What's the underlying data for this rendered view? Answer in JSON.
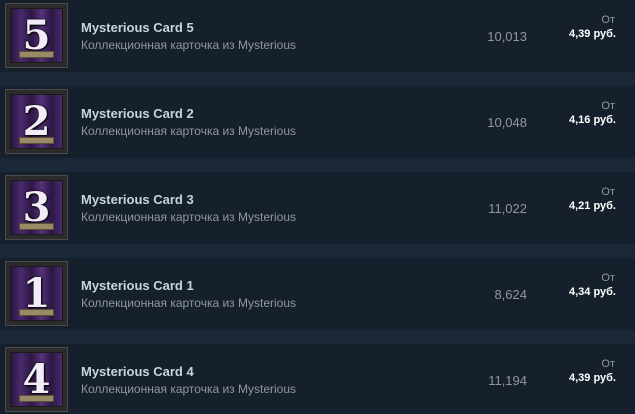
{
  "listings": [
    {
      "card_number": "5",
      "name": "Mysterious Card 5",
      "subtitle": "Коллекционная карточка из Mysterious",
      "quantity": "10,013",
      "from_label": "От",
      "price": "4,39 руб."
    },
    {
      "card_number": "2",
      "name": "Mysterious Card 2",
      "subtitle": "Коллекционная карточка из Mysterious",
      "quantity": "10,048",
      "from_label": "От",
      "price": "4,16 руб."
    },
    {
      "card_number": "3",
      "name": "Mysterious Card 3",
      "subtitle": "Коллекционная карточка из Mysterious",
      "quantity": "11,022",
      "from_label": "От",
      "price": "4,21 руб."
    },
    {
      "card_number": "1",
      "name": "Mysterious Card 1",
      "subtitle": "Коллекционная карточка из Mysterious",
      "quantity": "8,624",
      "from_label": "От",
      "price": "4,34 руб."
    },
    {
      "card_number": "4",
      "name": "Mysterious Card 4",
      "subtitle": "Коллекционная карточка из Mysterious",
      "quantity": "11,194",
      "from_label": "От",
      "price": "4,39 руб."
    }
  ],
  "colors": {
    "page_background": "#1b2838",
    "row_background": "#16202d",
    "name_text": "#c6d4df",
    "muted_text": "#8f98a0",
    "price_text": "#ffffff",
    "card_purple": "#4a2a6e"
  }
}
